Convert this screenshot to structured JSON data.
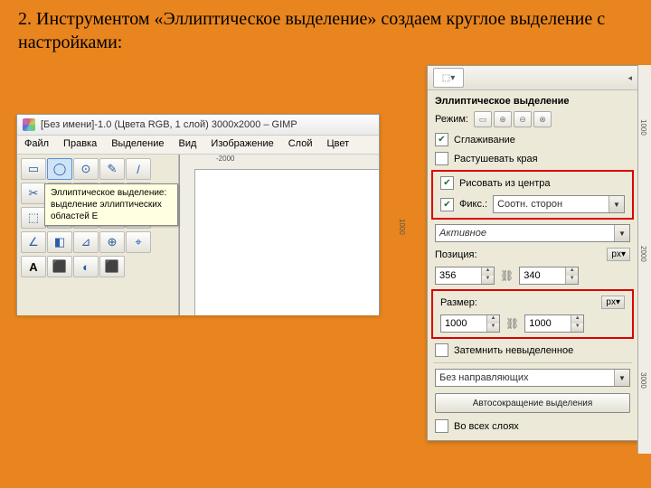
{
  "instruction": "2. Инструментом «Эллиптическое выделение» создаем круглое выделение с настройками:",
  "gimp": {
    "title": "[Без имени]-1.0 (Цвета RGB, 1 слой) 3000x2000 – GIMP",
    "menus": [
      "Файл",
      "Правка",
      "Выделение",
      "Вид",
      "Изображение",
      "Слой",
      "Цвет"
    ],
    "ruler_top": "-2000",
    "ruler_side": "1000",
    "tooltip_title": "Эллиптическое выделение:",
    "tooltip_body": "выделение эллиптических областей  E",
    "tools": [
      "▭",
      "◯",
      "⊙",
      "✎",
      "/",
      "✂",
      "⌖",
      "↔",
      "⟲",
      "⤡",
      "⬚",
      "⇱",
      "⇲",
      "⌂",
      "▭",
      "∠",
      "◧",
      "⊿",
      "⊕",
      "⌖",
      "A",
      "⬛",
      "◐",
      "⬛"
    ]
  },
  "opts": {
    "title": "Эллиптическое выделение",
    "mode_label": "Режим:",
    "antialias": "Сглаживание",
    "feather": "Растушевать края",
    "from_center": "Рисовать из центра",
    "fixed_label": "Фикс.:",
    "fixed_value": "Соотн. сторон",
    "active": "Активное",
    "position_label": "Позиция:",
    "pos_x": "356",
    "pos_y": "340",
    "size_label": "Размер:",
    "size_w": "1000",
    "size_h": "1000",
    "unit": "px▾",
    "darken": "Затемнить невыделенное",
    "guides": "Без направляющих",
    "autoshrink": "Автосокращение выделения",
    "all_layers": "Во всех слоях"
  },
  "ruler_marks": [
    "1000",
    "2000",
    "3000"
  ]
}
